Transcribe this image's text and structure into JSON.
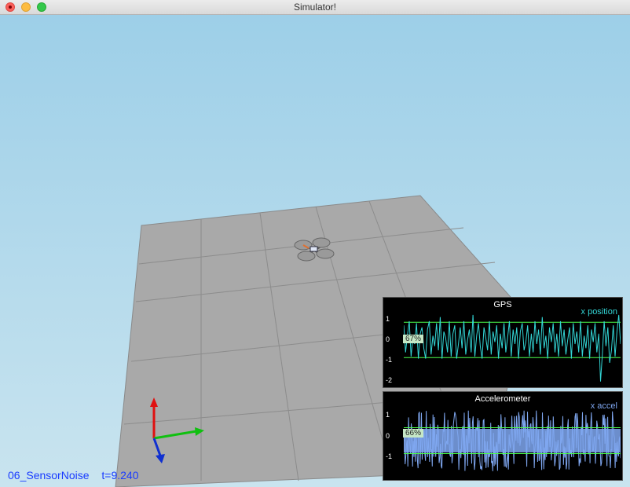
{
  "window": {
    "title": "Simulator!"
  },
  "status": {
    "scenario": "06_SensorNoise",
    "time": "t=9.240"
  },
  "colors": {
    "gps_line": "#33d6d6",
    "accel_fill": "#7fa7f0",
    "threshold": "#4cff4c"
  },
  "icons": {
    "drone": "quadcopter-icon",
    "axes": "xyz-axes-gizmo"
  },
  "chart_data": [
    {
      "type": "line",
      "title": "GPS",
      "series": [
        {
          "name": "x position",
          "values": [
            0.7,
            -0.6,
            0.2,
            0.9,
            -0.8,
            0.1,
            -0.2,
            0.8,
            -0.9,
            0.3,
            0.6,
            -0.4,
            -0.9,
            0.5,
            0.9,
            -0.7,
            0.2,
            -0.3,
            0.8,
            -0.5,
            1.1,
            -0.9,
            0.4,
            0.1,
            -0.6,
            0.9,
            -0.8,
            0.3,
            0.7,
            -0.9,
            -0.2,
            0.6,
            -0.4,
            0.9,
            -0.7,
            0.0,
            0.5,
            -0.6,
            1.2,
            -0.8,
            0.2,
            0.8,
            -0.3,
            -0.9,
            0.6,
            0.1,
            -0.5,
            0.9,
            -0.7,
            0.4,
            -0.1,
            0.7,
            -0.9,
            0.3,
            -0.4,
            0.8,
            -0.6,
            0.1,
            0.9,
            -0.8,
            0.5,
            -0.2,
            0.6,
            -0.9,
            0.4,
            0.8,
            -0.5,
            -0.1,
            0.7,
            -0.8,
            0.3,
            -0.6,
            0.9,
            -0.2,
            0.5,
            -0.7,
            1.1,
            -0.4,
            0.2,
            -0.9,
            0.6,
            -0.1,
            0.8,
            -0.6,
            0.3,
            -0.8,
            0.9,
            -0.3,
            0.5,
            -0.7,
            0.0,
            0.6,
            -0.9,
            0.8,
            -0.2,
            0.4,
            -0.6,
            0.9,
            -0.8,
            0.2,
            -0.4,
            0.7,
            -0.9,
            0.5,
            -0.1,
            0.8,
            -0.6,
            0.3,
            -2.0,
            -0.7,
            0.9,
            -0.3,
            0.6,
            -1.1,
            -0.5,
            0.7,
            -0.8,
            0.4,
            1.2,
            -0.2
          ]
        }
      ],
      "yticks": [
        "1",
        "0",
        "-1",
        "-2"
      ],
      "ylim": [
        -2.2,
        1.5
      ],
      "thresholds": [
        0.85,
        -0.85
      ],
      "percent_label": "67%",
      "grid": false
    },
    {
      "type": "area",
      "title": "Accelerometer",
      "series": [
        {
          "name": "x accel"
        }
      ],
      "yticks": [
        "1",
        "0",
        "-1"
      ],
      "ylim": [
        -1.6,
        1.6
      ],
      "thresholds": [
        0.55,
        -0.55
      ],
      "percent_label": "66%",
      "grid": false
    }
  ]
}
